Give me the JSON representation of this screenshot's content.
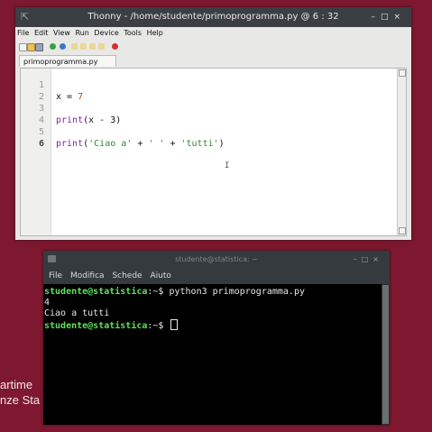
{
  "background": {
    "text_line1": "artime",
    "text_line2": "nze Sta"
  },
  "thonny": {
    "title": "Thonny  -  /home/studente/primoprogramma.py  @  6 : 32",
    "menu": [
      "File",
      "Edit",
      "View",
      "Run",
      "Device",
      "Tools",
      "Help"
    ],
    "tab_label": "primoprogramma.py",
    "line_numbers": [
      "1",
      "2",
      "3",
      "4",
      "5",
      "6"
    ],
    "code": {
      "line2": {
        "var": "x",
        "op": " = ",
        "num": "7"
      },
      "line4": {
        "fn": "print",
        "rest": "(x - 3)"
      },
      "line6": {
        "fn": "print",
        "open": "(",
        "s1": "'Ciao a'",
        "plus1": " + ",
        "s2": "' '",
        "plus2": " + ",
        "s3": "'tutti'",
        "close": ")"
      }
    }
  },
  "terminal": {
    "title": "studente@statistica: ~",
    "menu": [
      "File",
      "Modifica",
      "Schede",
      "Aiuto"
    ],
    "lines": {
      "l1_user": "studente@statistica",
      "l1_rest": ":~$ python3 primoprogramma.py",
      "l2": "4",
      "l3": "Ciao a tutti",
      "l4_user": "studente@statistica",
      "l4_rest": ":~$ "
    }
  },
  "colors": {
    "desktop_background": "#7d1830",
    "terminal_prompt": "#5fe05f",
    "keyword": "#7a2a98",
    "number": "#b53a1f",
    "string": "#2f8a2f"
  },
  "icons": [
    "window-icon",
    "new-file-icon",
    "open-file-icon",
    "save-file-icon",
    "run-icon",
    "debug-icon",
    "step-over-icon",
    "step-into-icon",
    "step-out-icon",
    "resume-icon",
    "stop-icon",
    "text-cursor-icon",
    "terminal-icon"
  ]
}
